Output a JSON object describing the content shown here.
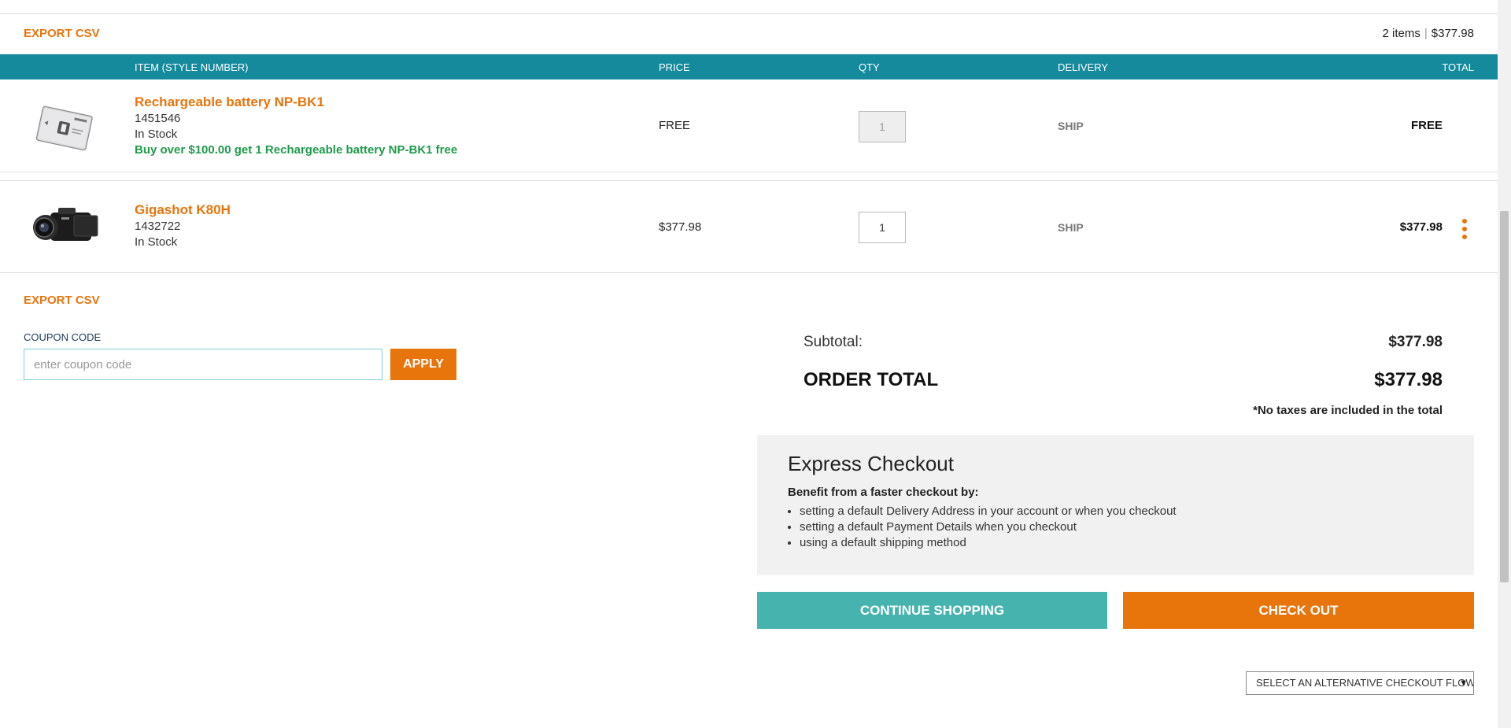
{
  "header": {
    "export_label": "EXPORT CSV",
    "item_count": "2 items",
    "cart_total": "$377.98"
  },
  "table": {
    "columns": [
      "ITEM (STYLE NUMBER)",
      "PRICE",
      "QTY",
      "DELIVERY",
      "TOTAL"
    ],
    "rows": [
      {
        "name": "Rechargeable battery NP-BK1",
        "sku": "1451546",
        "stock": "In Stock",
        "promo": "Buy over $100.00 get 1 Rechargeable battery NP-BK1 free",
        "price": "FREE",
        "qty": "1",
        "delivery": "SHIP",
        "total": "FREE",
        "icon": "battery-image"
      },
      {
        "name": "Gigashot K80H",
        "sku": "1432722",
        "stock": "In Stock",
        "price": "$377.98",
        "qty": "1",
        "delivery": "SHIP",
        "total": "$377.98",
        "icon": "camcorder-image"
      }
    ]
  },
  "footer": {
    "export_label": "EXPORT CSV"
  },
  "coupon": {
    "label": "COUPON CODE",
    "placeholder": "enter coupon code",
    "apply_label": "APPLY"
  },
  "totals": {
    "subtotal_label": "Subtotal:",
    "subtotal_value": "$377.98",
    "order_total_label": "ORDER TOTAL",
    "order_total_value": "$377.98",
    "tax_note": "*No taxes are included in the total"
  },
  "express": {
    "title": "Express Checkout",
    "subtitle": "Benefit from a faster checkout by:",
    "items": [
      "setting a default Delivery Address in your account or when you checkout",
      "setting a default Payment Details when you checkout",
      "using a default shipping method"
    ]
  },
  "actions": {
    "continue_label": "CONTINUE SHOPPING",
    "checkout_label": "CHECK OUT",
    "alt_checkout_selected": "SELECT AN ALTERNATIVE CHECKOUT FLOW"
  },
  "colors": {
    "accent": "#e8740c",
    "header_bg": "#148a9c",
    "continue_bg": "#47b3ae",
    "promo": "#1e9c4a"
  }
}
